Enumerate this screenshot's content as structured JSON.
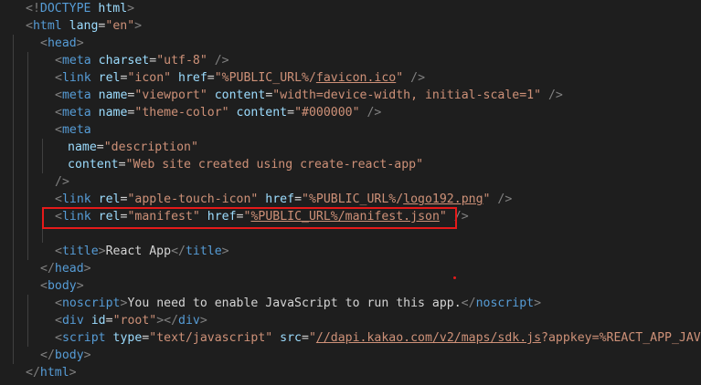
{
  "colors": {
    "background": "#1e1e1e",
    "punctuation": "#808080",
    "tag": "#569cd6",
    "attribute": "#9cdcfe",
    "string": "#ce9178",
    "text": "#d4d4d4",
    "highlight_box": "#e51a1a"
  },
  "lines": [
    {
      "indent": 1,
      "segs": [
        {
          "t": "punc",
          "v": "<!"
        },
        {
          "t": "tag",
          "v": "DOCTYPE"
        },
        {
          "t": "attr",
          "v": " html"
        },
        {
          "t": "punc",
          "v": ">"
        }
      ]
    },
    {
      "indent": 1,
      "segs": [
        {
          "t": "punc",
          "v": "<"
        },
        {
          "t": "tag",
          "v": "html"
        },
        {
          "t": "attr",
          "v": " lang"
        },
        {
          "t": "txt",
          "v": "="
        },
        {
          "t": "str",
          "v": "\"en\""
        },
        {
          "t": "punc",
          "v": ">"
        }
      ]
    },
    {
      "indent": 2,
      "segs": [
        {
          "t": "punc",
          "v": "<"
        },
        {
          "t": "tag",
          "v": "head"
        },
        {
          "t": "punc",
          "v": ">"
        }
      ]
    },
    {
      "indent": 3,
      "segs": [
        {
          "t": "punc",
          "v": "<"
        },
        {
          "t": "tag",
          "v": "meta"
        },
        {
          "t": "attr",
          "v": " charset"
        },
        {
          "t": "txt",
          "v": "="
        },
        {
          "t": "str",
          "v": "\"utf-8\""
        },
        {
          "t": "punc",
          "v": " />"
        }
      ]
    },
    {
      "indent": 3,
      "segs": [
        {
          "t": "punc",
          "v": "<"
        },
        {
          "t": "tag",
          "v": "link"
        },
        {
          "t": "attr",
          "v": " rel"
        },
        {
          "t": "txt",
          "v": "="
        },
        {
          "t": "str",
          "v": "\"icon\""
        },
        {
          "t": "attr",
          "v": " href"
        },
        {
          "t": "txt",
          "v": "="
        },
        {
          "t": "str",
          "v": "\"%PUBLIC_URL%/"
        },
        {
          "t": "str_u",
          "v": "favicon.ico"
        },
        {
          "t": "str",
          "v": "\""
        },
        {
          "t": "punc",
          "v": " />"
        }
      ]
    },
    {
      "indent": 3,
      "segs": [
        {
          "t": "punc",
          "v": "<"
        },
        {
          "t": "tag",
          "v": "meta"
        },
        {
          "t": "attr",
          "v": " name"
        },
        {
          "t": "txt",
          "v": "="
        },
        {
          "t": "str",
          "v": "\"viewport\""
        },
        {
          "t": "attr",
          "v": " content"
        },
        {
          "t": "txt",
          "v": "="
        },
        {
          "t": "str",
          "v": "\"width=device-width, initial-scale=1\""
        },
        {
          "t": "punc",
          "v": " />"
        }
      ]
    },
    {
      "indent": 3,
      "segs": [
        {
          "t": "punc",
          "v": "<"
        },
        {
          "t": "tag",
          "v": "meta"
        },
        {
          "t": "attr",
          "v": " name"
        },
        {
          "t": "txt",
          "v": "="
        },
        {
          "t": "str",
          "v": "\"theme-color\""
        },
        {
          "t": "attr",
          "v": " content"
        },
        {
          "t": "txt",
          "v": "="
        },
        {
          "t": "str",
          "v": "\"#000000\""
        },
        {
          "t": "punc",
          "v": " />"
        }
      ]
    },
    {
      "indent": 3,
      "segs": [
        {
          "t": "punc",
          "v": "<"
        },
        {
          "t": "tag",
          "v": "meta"
        }
      ]
    },
    {
      "indent": 4,
      "segs": [
        {
          "t": "attr",
          "v": "name"
        },
        {
          "t": "txt",
          "v": "="
        },
        {
          "t": "str",
          "v": "\"description\""
        }
      ]
    },
    {
      "indent": 4,
      "segs": [
        {
          "t": "attr",
          "v": "content"
        },
        {
          "t": "txt",
          "v": "="
        },
        {
          "t": "str",
          "v": "\"Web site created using create-react-app\""
        }
      ]
    },
    {
      "indent": 3,
      "segs": [
        {
          "t": "punc",
          "v": "/>"
        }
      ]
    },
    {
      "indent": 3,
      "segs": [
        {
          "t": "punc",
          "v": "<"
        },
        {
          "t": "tag",
          "v": "link"
        },
        {
          "t": "attr",
          "v": " rel"
        },
        {
          "t": "txt",
          "v": "="
        },
        {
          "t": "str",
          "v": "\"apple-touch-icon\""
        },
        {
          "t": "attr",
          "v": " href"
        },
        {
          "t": "txt",
          "v": "="
        },
        {
          "t": "str",
          "v": "\"%PUBLIC_URL%/"
        },
        {
          "t": "str_u",
          "v": "logo192.png"
        },
        {
          "t": "str",
          "v": "\""
        },
        {
          "t": "punc",
          "v": " />"
        }
      ]
    },
    {
      "indent": 3,
      "segs": [
        {
          "t": "punc",
          "v": "<"
        },
        {
          "t": "tag",
          "v": "link"
        },
        {
          "t": "attr",
          "v": " rel"
        },
        {
          "t": "txt",
          "v": "="
        },
        {
          "t": "str",
          "v": "\"manifest\""
        },
        {
          "t": "attr",
          "v": " href"
        },
        {
          "t": "txt",
          "v": "="
        },
        {
          "t": "str",
          "v": "\""
        },
        {
          "t": "str_u",
          "v": "%PUBLIC_URL%/manifest.json"
        },
        {
          "t": "str",
          "v": "\""
        },
        {
          "t": "punc",
          "v": " />"
        }
      ]
    },
    {
      "indent": 0,
      "segs": []
    },
    {
      "indent": 3,
      "segs": [
        {
          "t": "punc",
          "v": "<"
        },
        {
          "t": "tag",
          "v": "title"
        },
        {
          "t": "punc",
          "v": ">"
        },
        {
          "t": "txt",
          "v": "React App"
        },
        {
          "t": "punc",
          "v": "</"
        },
        {
          "t": "tag",
          "v": "title"
        },
        {
          "t": "punc",
          "v": ">"
        }
      ]
    },
    {
      "indent": 2,
      "segs": [
        {
          "t": "punc",
          "v": "</"
        },
        {
          "t": "tag",
          "v": "head"
        },
        {
          "t": "punc",
          "v": ">"
        }
      ]
    },
    {
      "indent": 2,
      "segs": [
        {
          "t": "punc",
          "v": "<"
        },
        {
          "t": "tag",
          "v": "body"
        },
        {
          "t": "punc",
          "v": ">"
        }
      ]
    },
    {
      "indent": 3,
      "segs": [
        {
          "t": "punc",
          "v": "<"
        },
        {
          "t": "tag",
          "v": "noscript"
        },
        {
          "t": "punc",
          "v": ">"
        },
        {
          "t": "txt",
          "v": "You need to enable JavaScript to run this app."
        },
        {
          "t": "punc",
          "v": "</"
        },
        {
          "t": "tag",
          "v": "noscript"
        },
        {
          "t": "punc",
          "v": ">"
        }
      ]
    },
    {
      "indent": 3,
      "segs": [
        {
          "t": "punc",
          "v": "<"
        },
        {
          "t": "tag",
          "v": "div"
        },
        {
          "t": "attr",
          "v": " id"
        },
        {
          "t": "txt",
          "v": "="
        },
        {
          "t": "str",
          "v": "\"root\""
        },
        {
          "t": "punc",
          "v": "></"
        },
        {
          "t": "tag",
          "v": "div"
        },
        {
          "t": "punc",
          "v": ">"
        }
      ]
    },
    {
      "indent": 3,
      "segs": [
        {
          "t": "punc",
          "v": "<"
        },
        {
          "t": "tag",
          "v": "script"
        },
        {
          "t": "attr",
          "v": " type"
        },
        {
          "t": "txt",
          "v": "="
        },
        {
          "t": "str",
          "v": "\"text/javascript\""
        },
        {
          "t": "attr",
          "v": " src"
        },
        {
          "t": "txt",
          "v": "="
        },
        {
          "t": "str",
          "v": "\""
        },
        {
          "t": "str_u",
          "v": "//dapi.kakao.com/v2/maps/sdk.js"
        },
        {
          "t": "str",
          "v": "?appkey=%REACT_APP_JAVA_SC"
        }
      ]
    },
    {
      "indent": 2,
      "segs": [
        {
          "t": "punc",
          "v": "</"
        },
        {
          "t": "tag",
          "v": "body"
        },
        {
          "t": "punc",
          "v": ">"
        }
      ]
    },
    {
      "indent": 1,
      "segs": [
        {
          "t": "punc",
          "v": "</"
        },
        {
          "t": "tag",
          "v": "html"
        },
        {
          "t": "punc",
          "v": ">"
        }
      ]
    }
  ]
}
